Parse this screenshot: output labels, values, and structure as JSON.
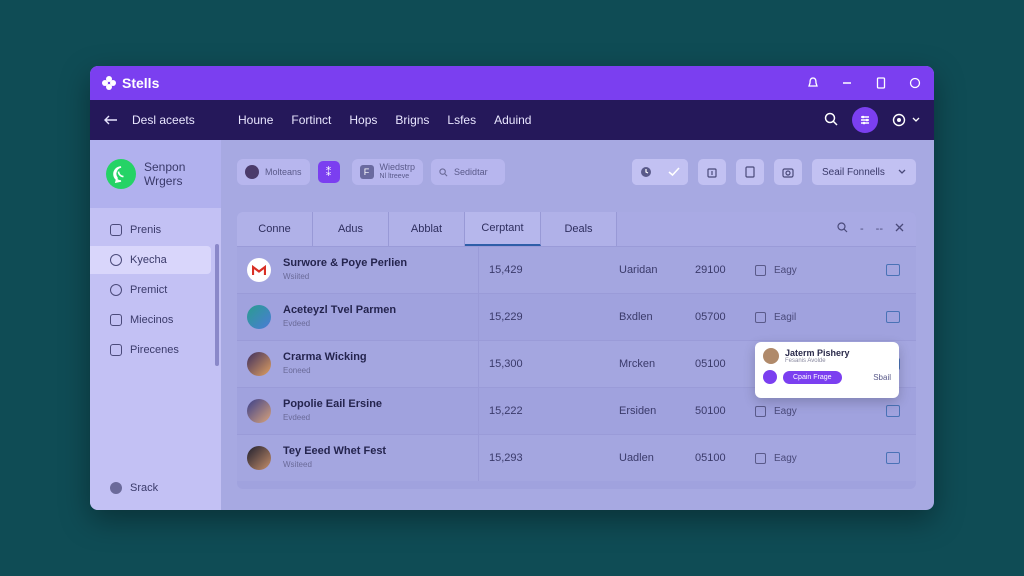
{
  "app": {
    "title": "Stells"
  },
  "navbar": {
    "back_label": "Desl aceets",
    "links": [
      "Houne",
      "Fortinct",
      "Hops",
      "Brigns",
      "Lsfes",
      "Aduind"
    ]
  },
  "sidebar": {
    "header": [
      "Senpon",
      "Wrgers"
    ],
    "items": [
      {
        "label": "Prenis",
        "active": false
      },
      {
        "label": "Kyecha",
        "active": true
      },
      {
        "label": "Premict",
        "active": false
      },
      {
        "label": "Miecinos",
        "active": false
      },
      {
        "label": "Pirecenes",
        "active": false
      }
    ],
    "bottom_label": "Srack"
  },
  "toolbar": {
    "chip1": "Molteans",
    "chip3_title": "Wiedstrp",
    "chip3_sub": "Nl ltreeve",
    "search_placeholder": "Sedidtar",
    "select_value": "Seail Fonnells"
  },
  "tabs": [
    "Conne",
    "Adus",
    "Abblat",
    "Cerptant",
    "Deals"
  ],
  "active_tab": 3,
  "rows": [
    {
      "name": "Surwore & Poye Perlien",
      "sub": "Wsiited",
      "num": "15,429",
      "city": "Uaridan",
      "value": "29100",
      "status": "Eagy",
      "avatar_color": "#ffffff",
      "avatar_accent": "#d93025"
    },
    {
      "name": "Aceteyzl Tvel Parmen",
      "sub": "Evdeed",
      "num": "15,229",
      "city": "Bxdlen",
      "value": "05700",
      "status": "Eagil",
      "avatar_color": "#2a9d8f",
      "avatar_accent": "#4a7bd8"
    },
    {
      "name": "Crarma Wicking",
      "sub": "Eoneed",
      "num": "15,300",
      "city": "Mrcken",
      "value": "05100",
      "status": "",
      "avatar_color": "#3d2e5e",
      "avatar_accent": "#e0a060"
    },
    {
      "name": "Popolie Eail Ersine",
      "sub": "Evdeed",
      "num": "15,222",
      "city": "Ersiden",
      "value": "50100",
      "status": "Eagy",
      "avatar_color": "#3a3f8a",
      "avatar_accent": "#d9a37a"
    },
    {
      "name": "Tey Eeed Whet Fest",
      "sub": "Wsiteed",
      "num": "15,293",
      "city": "Uadlen",
      "value": "05100",
      "status": "Eagy",
      "avatar_color": "#1e1e2e",
      "avatar_accent": "#c68f6a"
    }
  ],
  "popup": {
    "name": "Jaterm Pishery",
    "sub": "Fesanis Avolde",
    "button": "Cpain Frage",
    "link": "Sbail"
  },
  "colors": {
    "accent": "#7b3ff0",
    "navbar": "#25185a",
    "background": "#0f4c55"
  }
}
